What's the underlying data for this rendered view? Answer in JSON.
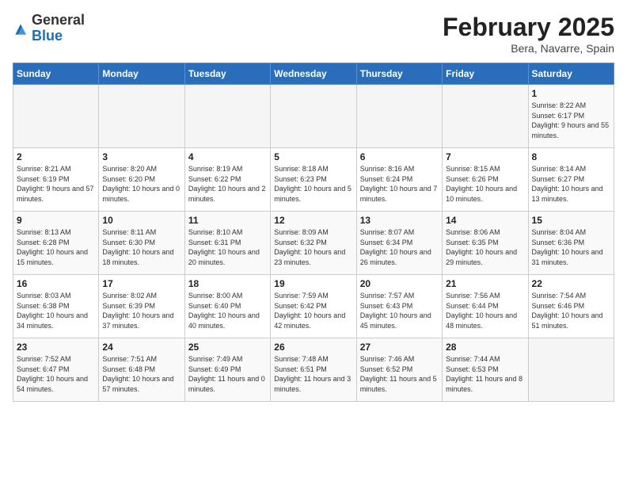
{
  "logo": {
    "general": "General",
    "blue": "Blue"
  },
  "title": "February 2025",
  "subtitle": "Bera, Navarre, Spain",
  "days_header": [
    "Sunday",
    "Monday",
    "Tuesday",
    "Wednesday",
    "Thursday",
    "Friday",
    "Saturday"
  ],
  "weeks": [
    [
      {
        "day": "",
        "info": ""
      },
      {
        "day": "",
        "info": ""
      },
      {
        "day": "",
        "info": ""
      },
      {
        "day": "",
        "info": ""
      },
      {
        "day": "",
        "info": ""
      },
      {
        "day": "",
        "info": ""
      },
      {
        "day": "1",
        "info": "Sunrise: 8:22 AM\nSunset: 6:17 PM\nDaylight: 9 hours and 55 minutes."
      }
    ],
    [
      {
        "day": "2",
        "info": "Sunrise: 8:21 AM\nSunset: 6:19 PM\nDaylight: 9 hours and 57 minutes."
      },
      {
        "day": "3",
        "info": "Sunrise: 8:20 AM\nSunset: 6:20 PM\nDaylight: 10 hours and 0 minutes."
      },
      {
        "day": "4",
        "info": "Sunrise: 8:19 AM\nSunset: 6:22 PM\nDaylight: 10 hours and 2 minutes."
      },
      {
        "day": "5",
        "info": "Sunrise: 8:18 AM\nSunset: 6:23 PM\nDaylight: 10 hours and 5 minutes."
      },
      {
        "day": "6",
        "info": "Sunrise: 8:16 AM\nSunset: 6:24 PM\nDaylight: 10 hours and 7 minutes."
      },
      {
        "day": "7",
        "info": "Sunrise: 8:15 AM\nSunset: 6:26 PM\nDaylight: 10 hours and 10 minutes."
      },
      {
        "day": "8",
        "info": "Sunrise: 8:14 AM\nSunset: 6:27 PM\nDaylight: 10 hours and 13 minutes."
      }
    ],
    [
      {
        "day": "9",
        "info": "Sunrise: 8:13 AM\nSunset: 6:28 PM\nDaylight: 10 hours and 15 minutes."
      },
      {
        "day": "10",
        "info": "Sunrise: 8:11 AM\nSunset: 6:30 PM\nDaylight: 10 hours and 18 minutes."
      },
      {
        "day": "11",
        "info": "Sunrise: 8:10 AM\nSunset: 6:31 PM\nDaylight: 10 hours and 20 minutes."
      },
      {
        "day": "12",
        "info": "Sunrise: 8:09 AM\nSunset: 6:32 PM\nDaylight: 10 hours and 23 minutes."
      },
      {
        "day": "13",
        "info": "Sunrise: 8:07 AM\nSunset: 6:34 PM\nDaylight: 10 hours and 26 minutes."
      },
      {
        "day": "14",
        "info": "Sunrise: 8:06 AM\nSunset: 6:35 PM\nDaylight: 10 hours and 29 minutes."
      },
      {
        "day": "15",
        "info": "Sunrise: 8:04 AM\nSunset: 6:36 PM\nDaylight: 10 hours and 31 minutes."
      }
    ],
    [
      {
        "day": "16",
        "info": "Sunrise: 8:03 AM\nSunset: 6:38 PM\nDaylight: 10 hours and 34 minutes."
      },
      {
        "day": "17",
        "info": "Sunrise: 8:02 AM\nSunset: 6:39 PM\nDaylight: 10 hours and 37 minutes."
      },
      {
        "day": "18",
        "info": "Sunrise: 8:00 AM\nSunset: 6:40 PM\nDaylight: 10 hours and 40 minutes."
      },
      {
        "day": "19",
        "info": "Sunrise: 7:59 AM\nSunset: 6:42 PM\nDaylight: 10 hours and 42 minutes."
      },
      {
        "day": "20",
        "info": "Sunrise: 7:57 AM\nSunset: 6:43 PM\nDaylight: 10 hours and 45 minutes."
      },
      {
        "day": "21",
        "info": "Sunrise: 7:56 AM\nSunset: 6:44 PM\nDaylight: 10 hours and 48 minutes."
      },
      {
        "day": "22",
        "info": "Sunrise: 7:54 AM\nSunset: 6:46 PM\nDaylight: 10 hours and 51 minutes."
      }
    ],
    [
      {
        "day": "23",
        "info": "Sunrise: 7:52 AM\nSunset: 6:47 PM\nDaylight: 10 hours and 54 minutes."
      },
      {
        "day": "24",
        "info": "Sunrise: 7:51 AM\nSunset: 6:48 PM\nDaylight: 10 hours and 57 minutes."
      },
      {
        "day": "25",
        "info": "Sunrise: 7:49 AM\nSunset: 6:49 PM\nDaylight: 11 hours and 0 minutes."
      },
      {
        "day": "26",
        "info": "Sunrise: 7:48 AM\nSunset: 6:51 PM\nDaylight: 11 hours and 3 minutes."
      },
      {
        "day": "27",
        "info": "Sunrise: 7:46 AM\nSunset: 6:52 PM\nDaylight: 11 hours and 5 minutes."
      },
      {
        "day": "28",
        "info": "Sunrise: 7:44 AM\nSunset: 6:53 PM\nDaylight: 11 hours and 8 minutes."
      },
      {
        "day": "",
        "info": ""
      }
    ]
  ]
}
